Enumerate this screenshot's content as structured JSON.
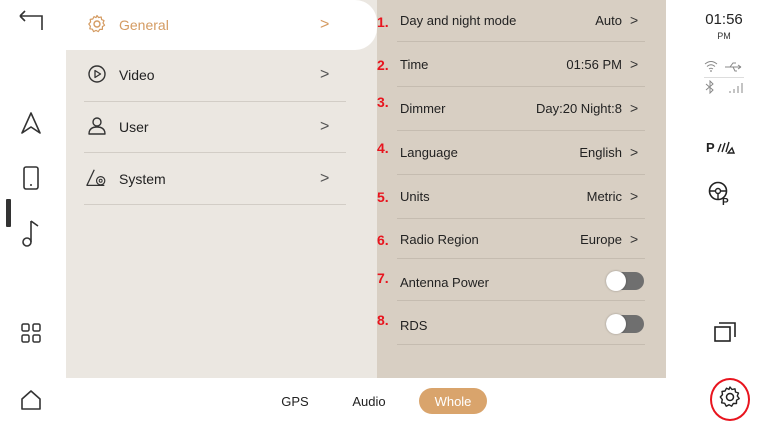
{
  "menu": {
    "items": [
      {
        "label": "General",
        "icon": "gear-icon",
        "chevron": ">",
        "active": true
      },
      {
        "label": "Video",
        "icon": "play-circle-icon",
        "chevron": ">"
      },
      {
        "label": "User",
        "icon": "user-icon",
        "chevron": ">"
      },
      {
        "label": "System",
        "icon": "system-triangle-gear-icon",
        "chevron": ">"
      }
    ]
  },
  "settings": {
    "rows": [
      {
        "num": "1.",
        "label": "Day and night mode",
        "value": "Auto",
        "chevron": ">"
      },
      {
        "num": "2.",
        "label": "Time",
        "value": "01:56 PM",
        "chevron": ">"
      },
      {
        "num": "3.",
        "label": "Dimmer",
        "value": "Day:20  Night:8",
        "chevron": ">"
      },
      {
        "num": "4.",
        "label": "Language",
        "value": "English",
        "chevron": ">"
      },
      {
        "num": "5.",
        "label": "Units",
        "value": "Metric",
        "chevron": ">"
      },
      {
        "num": "6.",
        "label": "Radio Region",
        "value": "Europe",
        "chevron": ">"
      },
      {
        "num": "7.",
        "label": "Antenna Power",
        "toggle": "off"
      },
      {
        "num": "8.",
        "label": "RDS",
        "toggle": "off"
      }
    ]
  },
  "bottom_tabs": [
    {
      "label": "GPS",
      "active": false
    },
    {
      "label": "Audio",
      "active": false
    },
    {
      "label": "Whole",
      "active": true
    }
  ],
  "status": {
    "time": "01:56",
    "ampm": "PM",
    "icons": [
      "wifi-icon",
      "usb-icon",
      "bluetooth-icon",
      "signal-bars-icon",
      "parking-sensor-icon",
      "steering-wheel-parking-icon",
      "multi-window-icon",
      "settings-gear-icon"
    ]
  },
  "left_rail": {
    "icons": [
      "back-icon",
      "navigation-icon",
      "phone-icon",
      "music-icon",
      "apps-grid-icon",
      "home-icon"
    ]
  },
  "colors": {
    "accent": "#d49b62",
    "menu_bg": "#ebe7e1",
    "list_bg": "#d8cfc3",
    "annotation_red": "#e8141e"
  }
}
